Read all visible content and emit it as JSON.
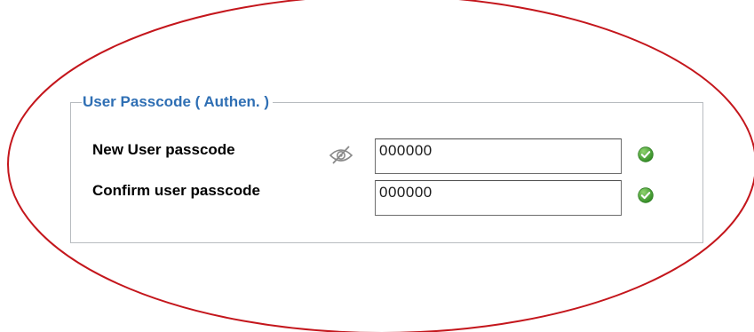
{
  "section": {
    "legend": "User Passcode ( Authen. )"
  },
  "fields": {
    "new_passcode": {
      "label": "New User passcode",
      "value": "000000",
      "toggle_icon": "eye-slash-icon",
      "status_icon": "check-circle-icon"
    },
    "confirm_passcode": {
      "label": "Confirm user passcode",
      "value": "000000",
      "status_icon": "check-circle-icon"
    }
  },
  "colors": {
    "legend": "#2f6fb4",
    "annotation_ellipse": "#c4161c",
    "valid_check": "#3a9a2a",
    "fieldset_border": "#b8bcc0"
  }
}
